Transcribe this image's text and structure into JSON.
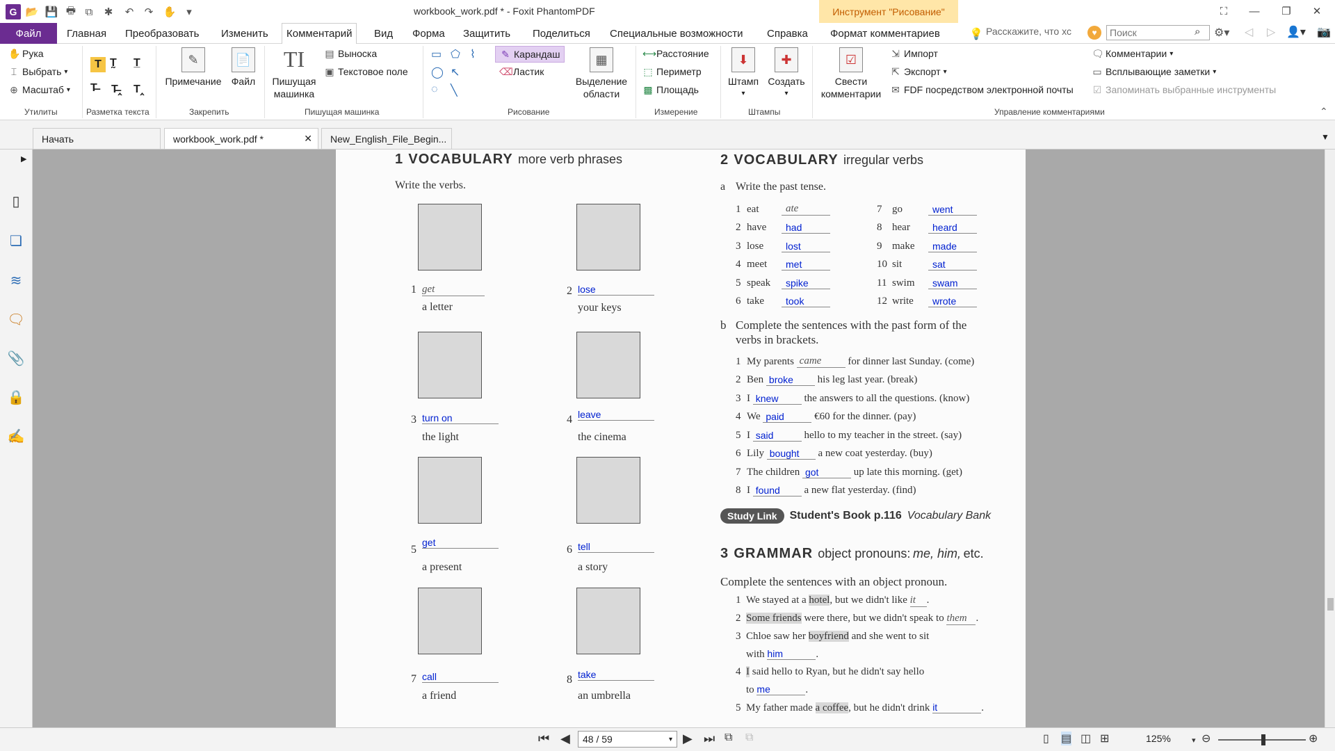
{
  "window": {
    "title": "workbook_work.pdf * - Foxit PhantomPDF",
    "tool_context": "Инструмент \"Рисование\""
  },
  "tabs": [
    {
      "label": "Файл"
    },
    {
      "label": "Главная"
    },
    {
      "label": "Преобразовать"
    },
    {
      "label": "Изменить"
    },
    {
      "label": "Комментарий"
    },
    {
      "label": "Вид"
    },
    {
      "label": "Форма"
    },
    {
      "label": "Защитить"
    },
    {
      "label": "Поделиться"
    },
    {
      "label": "Специальные возможности"
    },
    {
      "label": "Справка"
    },
    {
      "label": "Формат комментариев"
    }
  ],
  "tell_me": "Расскажите, что хс",
  "search": {
    "placeholder": "Поиск"
  },
  "ribbon": {
    "hand": "Рука",
    "select": "Выбрать",
    "zoom": "Масштаб",
    "group_utils": "Утилиты",
    "group_markup": "Разметка текста",
    "note": "Примечание",
    "file": "Файл",
    "group_pin": "Закрепить",
    "typewriter": "Пишущая машинка",
    "callout": "Выноска",
    "textfield": "Текстовое поле",
    "group_typewriter": "Пишущая машинка",
    "pencil": "Карандаш",
    "eraser": "Ластик",
    "group_drawing": "Рисование",
    "area_highlight": "Выделение области",
    "distance": "Расстояние",
    "perimeter": "Периметр",
    "area": "Площадь",
    "group_measure": "Измерение",
    "stamp": "Штамп",
    "create": "Создать",
    "group_stamps": "Штампы",
    "summarize": "Свести комментарии",
    "import": "Импорт",
    "export": "Экспорт",
    "fdf_email": "FDF посредством электронной почты",
    "comments": "Комментарии",
    "popup_notes": "Всплывающие заметки",
    "remember_tools": "Запоминать выбранные инструменты",
    "group_manage": "Управление комментариями"
  },
  "doc_tabs": [
    {
      "label": "Начать"
    },
    {
      "label": "workbook_work.pdf *"
    },
    {
      "label": "New_English_File_Begin..."
    }
  ],
  "status": {
    "page": "48 / 59",
    "zoom": "125%"
  },
  "page": {
    "s1": {
      "num": "1",
      "title": "VOCABULARY",
      "sub": "more verb phrases",
      "instr": "Write the verbs.",
      "items": [
        {
          "n": "1",
          "answer": "get",
          "prefilled": true,
          "phrase": "a letter"
        },
        {
          "n": "2",
          "answer": "lose",
          "phrase": "your keys"
        },
        {
          "n": "3",
          "answer": "turn on",
          "phrase": "the light"
        },
        {
          "n": "4",
          "answer": "leave",
          "phrase": "the cinema"
        },
        {
          "n": "5",
          "answer": "get",
          "phrase": "a present"
        },
        {
          "n": "6",
          "answer": "tell",
          "phrase": "a story"
        },
        {
          "n": "7",
          "answer": "call",
          "phrase": "a friend"
        },
        {
          "n": "8",
          "answer": "take",
          "phrase": "an umbrella"
        }
      ]
    },
    "s2": {
      "num": "2",
      "title": "VOCABULARY",
      "sub": "irregular verbs",
      "a_label": "a",
      "a_instr": "Write the past tense.",
      "verbs": [
        {
          "n": "1",
          "verb": "eat",
          "past": "ate"
        },
        {
          "n": "2",
          "verb": "have",
          "past": "had"
        },
        {
          "n": "3",
          "verb": "lose",
          "past": "lost"
        },
        {
          "n": "4",
          "verb": "meet",
          "past": "met"
        },
        {
          "n": "5",
          "verb": "speak",
          "past": "spike"
        },
        {
          "n": "6",
          "verb": "take",
          "past": "took"
        },
        {
          "n": "7",
          "verb": "go",
          "past": "went"
        },
        {
          "n": "8",
          "verb": "hear",
          "past": "heard"
        },
        {
          "n": "9",
          "verb": "make",
          "past": "made"
        },
        {
          "n": "10",
          "verb": "sit",
          "past": "sat"
        },
        {
          "n": "11",
          "verb": "swim",
          "past": "swam"
        },
        {
          "n": "12",
          "verb": "write",
          "past": "wrote"
        }
      ],
      "b_label": "b",
      "b_instr1": "Complete the sentences with the past form of the",
      "b_instr2": "verbs in brackets.",
      "sentences": [
        {
          "n": "1",
          "pre": "My parents",
          "ans": "came",
          "post": "for dinner last Sunday. (come)"
        },
        {
          "n": "2",
          "pre": "Ben",
          "ans": "broke",
          "post": "his leg last year. (break)"
        },
        {
          "n": "3",
          "pre": "I",
          "ans": "knew",
          "post": "the answers to all the questions. (know)"
        },
        {
          "n": "4",
          "pre": "We",
          "ans": "paid",
          "post": "€60 for the dinner. (pay)"
        },
        {
          "n": "5",
          "pre": "I",
          "ans": "said",
          "post": "hello to my teacher in the street. (say)"
        },
        {
          "n": "6",
          "pre": "Lily",
          "ans": "bought",
          "post": "a new coat yesterday. (buy)"
        },
        {
          "n": "7",
          "pre": "The children",
          "ans": "got",
          "post": "up late this morning. (get)"
        },
        {
          "n": "8",
          "pre": "I",
          "ans": "found",
          "post": "a new flat yesterday. (find)"
        }
      ]
    },
    "study_link": {
      "badge": "Study Link",
      "book": "Student's Book p.116",
      "bank": "Vocabulary Bank"
    },
    "s3": {
      "num": "3",
      "title": "GRAMMAR",
      "sub": "object pronouns:",
      "sub_it": "me, him,",
      "sub_etc": "etc.",
      "instr": "Complete the sentences with an object pronoun.",
      "l1": {
        "n": "1",
        "a": "We stayed at a",
        "hl": "hotel",
        "b": ", but we didn't like",
        "ans": "it"
      },
      "l2": {
        "n": "2",
        "hl": "Some friends",
        "a": "were there, but we didn't speak to",
        "ans": "them"
      },
      "l3": {
        "n": "3",
        "a": "Chloe saw her",
        "hl": "boyfriend",
        "b": "and she went to sit",
        "c": "with",
        "ans": "him"
      },
      "l4": {
        "n": "4",
        "hl": "I",
        "a": "said hello to Ryan, but he didn't say hello",
        "c": "to",
        "ans": "me"
      },
      "l5": {
        "n": "5",
        "a": "My father made",
        "hl": "a coffee",
        "b": ", but he didn't drink",
        "ans": "it"
      }
    }
  }
}
